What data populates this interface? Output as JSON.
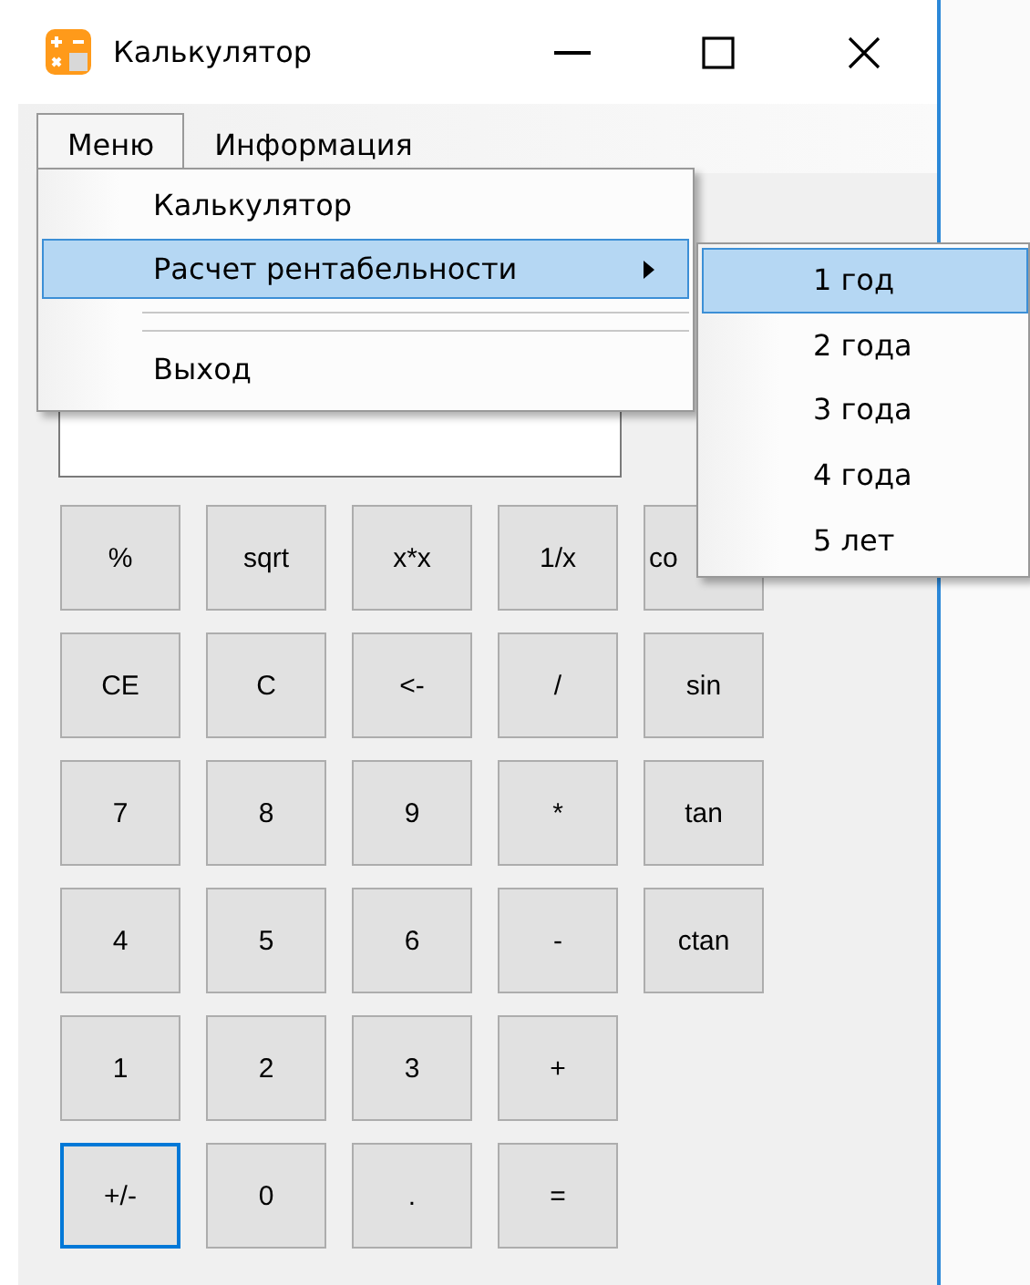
{
  "window": {
    "title": "Калькулятор"
  },
  "menu_bar": [
    {
      "label": "Меню",
      "selected": true
    },
    {
      "label": "Информация",
      "selected": false
    }
  ],
  "dropdown": [
    {
      "kind": "item",
      "label": "Калькулятор",
      "selected": false,
      "submenu": false
    },
    {
      "kind": "item",
      "label": "Расчет рентабельности",
      "selected": true,
      "submenu": true
    },
    {
      "kind": "separator"
    },
    {
      "kind": "separator"
    },
    {
      "kind": "item",
      "label": "Выход",
      "selected": false,
      "submenu": false
    }
  ],
  "submenu": [
    {
      "label": "1 год",
      "selected": true
    },
    {
      "label": "2 года",
      "selected": false
    },
    {
      "label": "3 года",
      "selected": false
    },
    {
      "label": "4 года",
      "selected": false
    },
    {
      "label": "5 лет",
      "selected": false
    }
  ],
  "keypad": [
    [
      {
        "label": "%",
        "focused": false
      },
      {
        "label": "sqrt",
        "focused": false
      },
      {
        "label": "x*x",
        "focused": false
      },
      {
        "label": "1/x",
        "focused": false
      },
      {
        "label": "co",
        "focused": false,
        "cut": true
      }
    ],
    [
      {
        "label": "CE",
        "focused": false
      },
      {
        "label": "C",
        "focused": false
      },
      {
        "label": "<-",
        "focused": false
      },
      {
        "label": "/",
        "focused": false
      },
      {
        "label": "sin",
        "focused": false
      }
    ],
    [
      {
        "label": "7",
        "focused": false
      },
      {
        "label": "8",
        "focused": false
      },
      {
        "label": "9",
        "focused": false
      },
      {
        "label": "*",
        "focused": false
      },
      {
        "label": "tan",
        "focused": false
      }
    ],
    [
      {
        "label": "4",
        "focused": false
      },
      {
        "label": "5",
        "focused": false
      },
      {
        "label": "6",
        "focused": false
      },
      {
        "label": "-",
        "focused": false
      },
      {
        "label": "ctan",
        "focused": false
      }
    ],
    [
      {
        "label": "1",
        "focused": false
      },
      {
        "label": "2",
        "focused": false
      },
      {
        "label": "3",
        "focused": false
      },
      {
        "label": "+",
        "focused": false
      }
    ],
    [
      {
        "label": "+/-",
        "focused": true
      },
      {
        "label": "0",
        "focused": false
      },
      {
        "label": ".",
        "focused": false
      },
      {
        "label": "=",
        "focused": false
      }
    ]
  ]
}
